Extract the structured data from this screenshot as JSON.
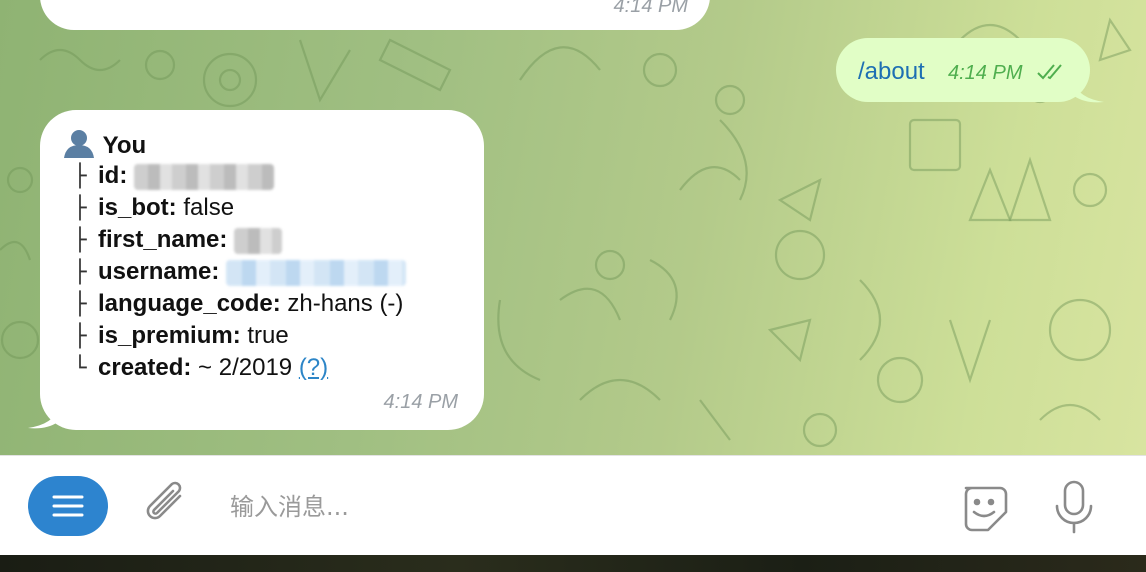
{
  "previous_message": {
    "time": "4:14 PM"
  },
  "outgoing_message": {
    "text": "/about",
    "time": "4:14 PM",
    "status_icon": "double-check-icon"
  },
  "incoming_message": {
    "title": "You",
    "title_icon": "user-silhouette-icon",
    "fields": [
      {
        "branch": "├",
        "key": "id:",
        "value": "",
        "redacted": true
      },
      {
        "branch": "├",
        "key": "is_bot:",
        "value": "false"
      },
      {
        "branch": "├",
        "key": "first_name:",
        "value": "",
        "redacted": true
      },
      {
        "branch": "├",
        "key": "username:",
        "value": "",
        "redacted": true
      },
      {
        "branch": "├",
        "key": "language_code:",
        "value": "zh-hans (-)"
      },
      {
        "branch": "├",
        "key": "is_premium:",
        "value": "true"
      },
      {
        "branch": "└",
        "key": "created:",
        "value": "~ 2/2019",
        "link": "(?)"
      }
    ],
    "time": "4:14 PM"
  },
  "composer": {
    "placeholder": "输入消息...",
    "menu_icon": "hamburger-menu-icon",
    "attach_icon": "paperclip-icon",
    "sticker_icon": "sticker-icon",
    "mic_icon": "microphone-icon"
  },
  "colors": {
    "outgoing_bubble": "#e1fec6",
    "incoming_bubble": "#ffffff",
    "accent": "#2d84cf",
    "link": "#2c85c7",
    "check": "#4fae4e"
  }
}
